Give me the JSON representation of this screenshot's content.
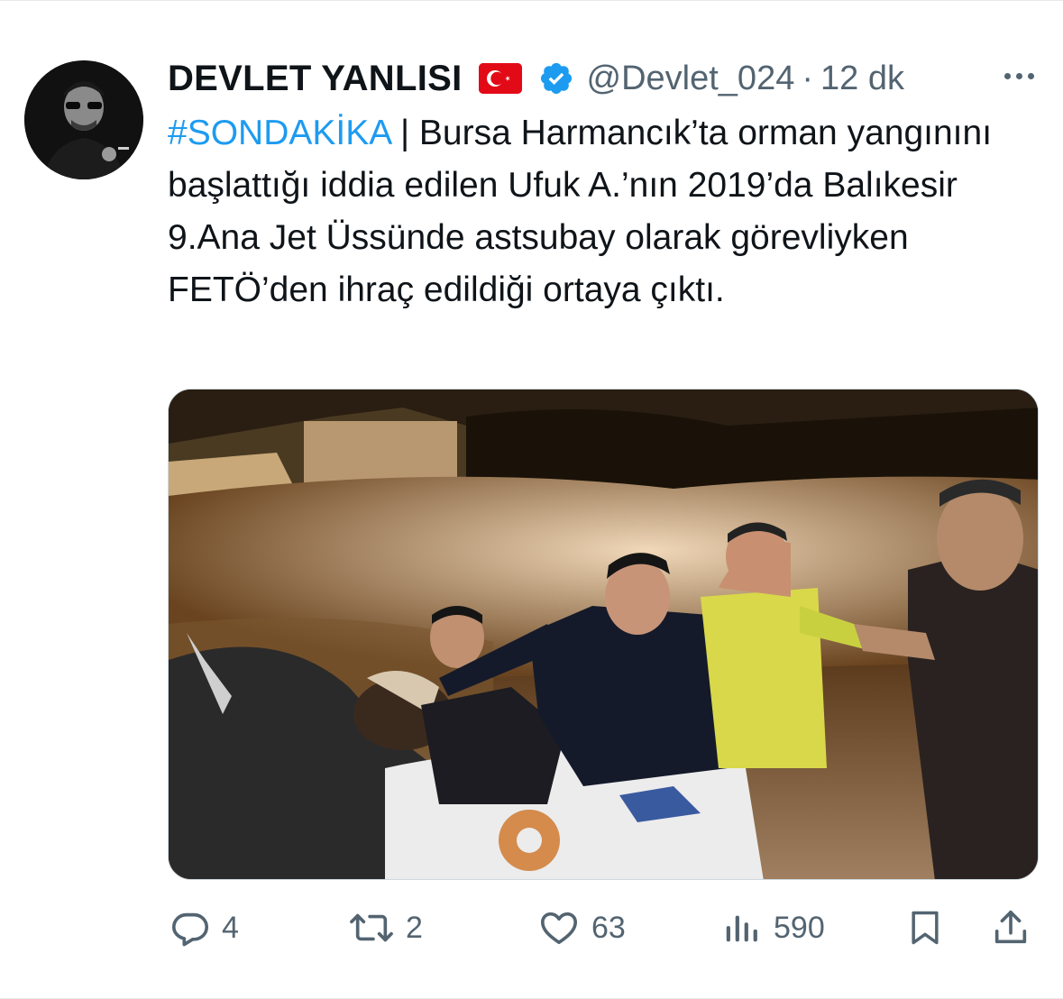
{
  "author": {
    "display_name": "DEVLET YANLISI",
    "flag_icon": "turkey-flag-icon",
    "verified_icon": "verified-badge-icon",
    "handle": "@Devlet_024",
    "separator": "·",
    "time": "12 dk"
  },
  "tweet": {
    "hashtag": "#SONDAKİKA",
    "body": " | Bursa Harmancık’ta orman yangınını başlattığı iddia edilen Ufuk A.’nın 2019’da Balıkesir 9.Ana Jet Üssünde astsubay olarak görevliyken FETÖ’den ihraç edildiği ortaya çıktı."
  },
  "media": {
    "description_icon": "photo"
  },
  "actions": {
    "replies": "4",
    "retweets": "2",
    "likes": "63",
    "views": "590"
  },
  "colors": {
    "accent": "#1d9bf0",
    "muted": "#536471",
    "text": "#0f1419",
    "flag_red": "#e30a17"
  }
}
